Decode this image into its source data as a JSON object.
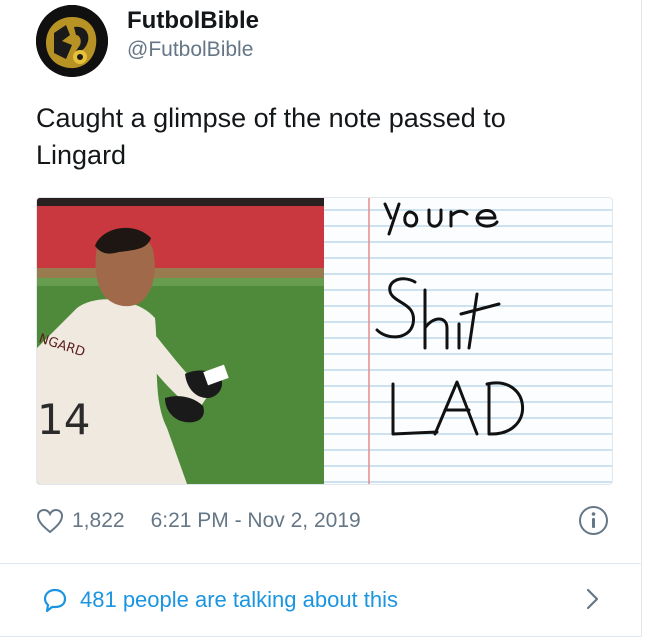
{
  "tweet": {
    "display_name": "FutbolBible",
    "handle": "@FutbolBible",
    "text": "Caught a glimpse of the note passed to Lingard",
    "media": {
      "jersey_text": "NGARD",
      "jersey_number": "14",
      "note_lines": [
        "youre",
        "Shit",
        "LAD"
      ]
    },
    "like_count": "1,822",
    "timestamp": "6:21 PM - Nov 2, 2019",
    "talking_text": "481 people are talking about this"
  },
  "colors": {
    "link_blue": "#1b95e0",
    "secondary_text": "#657786",
    "primary_text": "#14171a",
    "divider": "#e1e8ed"
  },
  "icons": {
    "like": "heart-outline-icon",
    "info": "info-circle-icon",
    "reply": "speech-bubble-icon",
    "chevron": "chevron-right-icon"
  }
}
